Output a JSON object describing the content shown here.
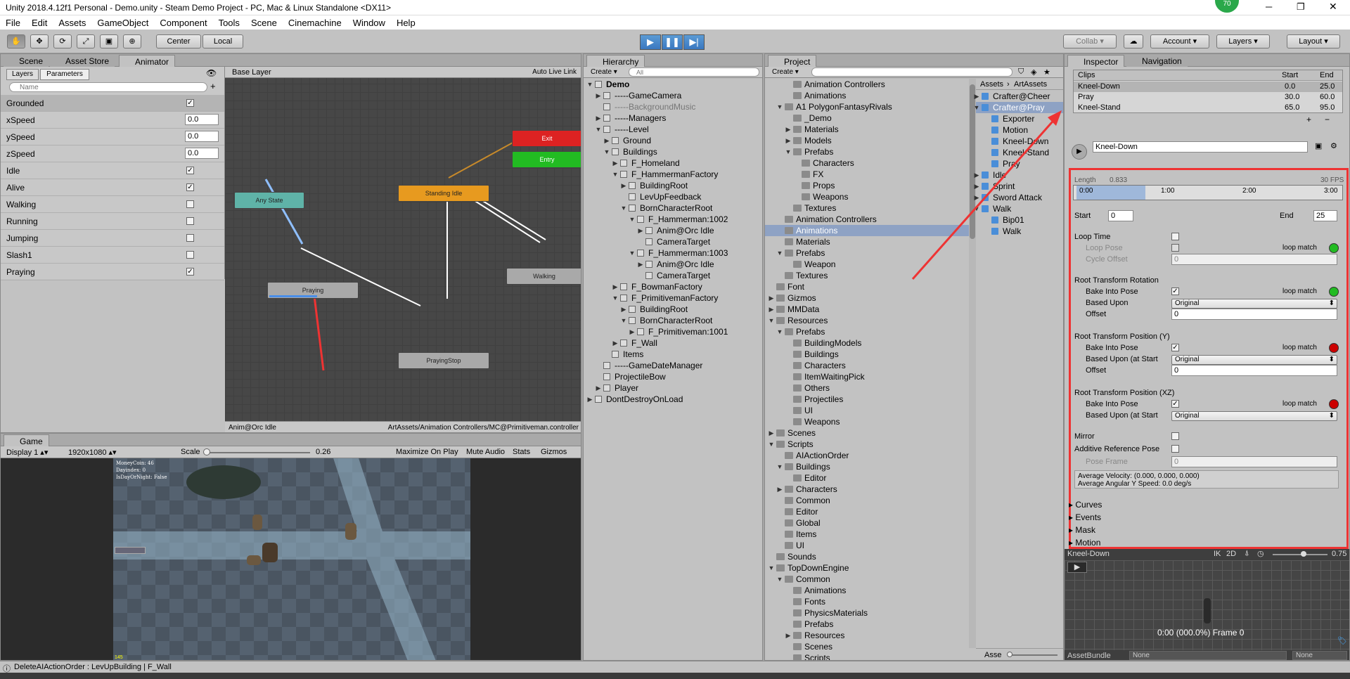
{
  "window": {
    "title": "Unity 2018.4.12f1 Personal - Demo.unity - Steam Demo Project - PC, Mac & Linux Standalone <DX11>",
    "badge": "70"
  },
  "menu": [
    "File",
    "Edit",
    "Assets",
    "GameObject",
    "Component",
    "Tools",
    "Scene",
    "Cinemachine",
    "Window",
    "Help"
  ],
  "toolbar": {
    "center": "Center",
    "local": "Local",
    "collab": "Collab",
    "account": "Account",
    "layers": "Layers",
    "layout": "Layout"
  },
  "animator_panel": {
    "tabs": [
      "Scene",
      "Asset Store",
      "Animator"
    ],
    "subtabs": [
      "Layers",
      "Parameters"
    ],
    "search_placeholder": "Name",
    "base_layer": "Base Layer",
    "auto_live": "Auto Live Link",
    "footer_left": "Anim@Orc Idle",
    "footer_right": "ArtAssets/Animation Controllers/MC@Primitiveman.controller",
    "params": [
      {
        "name": "Grounded",
        "type": "bool",
        "value": "true"
      },
      {
        "name": "xSpeed",
        "type": "float",
        "value": "0.0"
      },
      {
        "name": "ySpeed",
        "type": "float",
        "value": "0.0"
      },
      {
        "name": "zSpeed",
        "type": "float",
        "value": "0.0"
      },
      {
        "name": "Idle",
        "type": "bool",
        "value": "true"
      },
      {
        "name": "Alive",
        "type": "bool",
        "value": "true"
      },
      {
        "name": "Walking",
        "type": "bool",
        "value": "false"
      },
      {
        "name": "Running",
        "type": "bool",
        "value": "false"
      },
      {
        "name": "Jumping",
        "type": "bool",
        "value": "false"
      },
      {
        "name": "Slash1",
        "type": "bool",
        "value": "false"
      },
      {
        "name": "Praying",
        "type": "bool",
        "value": "true"
      }
    ],
    "nodes": {
      "exit": "Exit",
      "entry": "Entry",
      "any": "Any State",
      "standing": "Standing Idle",
      "praying": "Praying",
      "walking": "Walking",
      "prayingstop": "PrayingStop"
    }
  },
  "game_panel": {
    "tab": "Game",
    "display": "Display 1",
    "resolution": "1920x1080",
    "scale_label": "Scale",
    "scale_value": "0.26",
    "buttons": [
      "Maximize On Play",
      "Mute Audio",
      "Stats",
      "Gizmos"
    ],
    "hud": [
      "MoneyCoin: 46",
      "Dayindex: 0",
      "IsDayOrNight: False"
    ],
    "fps": "145"
  },
  "hierarchy": {
    "tab": "Hierarchy",
    "create": "Create",
    "search_placeholder": "All",
    "items": [
      {
        "t": "Demo",
        "d": 0,
        "f": "open",
        "bold": true
      },
      {
        "t": "-----GameCamera",
        "d": 1,
        "f": "closed"
      },
      {
        "t": "-----BackgroundMusic",
        "d": 1,
        "f": "",
        "gray": true
      },
      {
        "t": "-----Managers",
        "d": 1,
        "f": "closed"
      },
      {
        "t": "-----Level",
        "d": 1,
        "f": "open"
      },
      {
        "t": "Ground",
        "d": 2,
        "f": "closed"
      },
      {
        "t": "Buildings",
        "d": 2,
        "f": "open"
      },
      {
        "t": "F_Homeland",
        "d": 3,
        "f": "closed"
      },
      {
        "t": "F_HammermanFactory",
        "d": 3,
        "f": "open"
      },
      {
        "t": "BuildingRoot",
        "d": 4,
        "f": "closed"
      },
      {
        "t": "LevUpFeedback",
        "d": 4,
        "f": ""
      },
      {
        "t": "BornCharacterRoot",
        "d": 4,
        "f": "open"
      },
      {
        "t": "F_Hammerman:1002",
        "d": 5,
        "f": "open"
      },
      {
        "t": "Anim@Orc Idle",
        "d": 6,
        "f": "closed"
      },
      {
        "t": "CameraTarget",
        "d": 6,
        "f": ""
      },
      {
        "t": "F_Hammerman:1003",
        "d": 5,
        "f": "open"
      },
      {
        "t": "Anim@Orc Idle",
        "d": 6,
        "f": "closed"
      },
      {
        "t": "CameraTarget",
        "d": 6,
        "f": ""
      },
      {
        "t": "F_BowmanFactory",
        "d": 3,
        "f": "closed"
      },
      {
        "t": "F_PrimitivemanFactory",
        "d": 3,
        "f": "open"
      },
      {
        "t": "BuildingRoot",
        "d": 4,
        "f": "closed"
      },
      {
        "t": "BornCharacterRoot",
        "d": 4,
        "f": "open"
      },
      {
        "t": "F_Primitiveman:1001",
        "d": 5,
        "f": "closed"
      },
      {
        "t": "F_Wall",
        "d": 3,
        "f": "closed"
      },
      {
        "t": "Items",
        "d": 2,
        "f": ""
      },
      {
        "t": "-----GameDateManager",
        "d": 1,
        "f": ""
      },
      {
        "t": "ProjectileBow",
        "d": 1,
        "f": ""
      },
      {
        "t": "Player",
        "d": 1,
        "f": "closed"
      },
      {
        "t": "DontDestroyOnLoad",
        "d": 0,
        "f": "closed"
      }
    ]
  },
  "project": {
    "tab": "Project",
    "create": "Create",
    "tree": [
      {
        "t": "Animation Controllers",
        "d": 3,
        "f": ""
      },
      {
        "t": "Animations",
        "d": 3,
        "f": ""
      },
      {
        "t": "A1 PolygonFantasyRivals",
        "d": 2,
        "f": "open"
      },
      {
        "t": "_Demo",
        "d": 3,
        "f": ""
      },
      {
        "t": "Materials",
        "d": 3,
        "f": "closed"
      },
      {
        "t": "Models",
        "d": 3,
        "f": "closed"
      },
      {
        "t": "Prefabs",
        "d": 3,
        "f": "open"
      },
      {
        "t": "Characters",
        "d": 4,
        "f": ""
      },
      {
        "t": "FX",
        "d": 4,
        "f": ""
      },
      {
        "t": "Props",
        "d": 4,
        "f": ""
      },
      {
        "t": "Weapons",
        "d": 4,
        "f": ""
      },
      {
        "t": "Textures",
        "d": 3,
        "f": ""
      },
      {
        "t": "Animation Controllers",
        "d": 2,
        "f": ""
      },
      {
        "t": "Animations",
        "d": 2,
        "f": "",
        "sel": true
      },
      {
        "t": "Materials",
        "d": 2,
        "f": ""
      },
      {
        "t": "Prefabs",
        "d": 2,
        "f": "open"
      },
      {
        "t": "Weapon",
        "d": 3,
        "f": ""
      },
      {
        "t": "Textures",
        "d": 2,
        "f": ""
      },
      {
        "t": "Font",
        "d": 1,
        "f": ""
      },
      {
        "t": "Gizmos",
        "d": 1,
        "f": "closed"
      },
      {
        "t": "MMData",
        "d": 1,
        "f": "closed"
      },
      {
        "t": "Resources",
        "d": 1,
        "f": "open"
      },
      {
        "t": "Prefabs",
        "d": 2,
        "f": "open"
      },
      {
        "t": "BuildingModels",
        "d": 3,
        "f": ""
      },
      {
        "t": "Buildings",
        "d": 3,
        "f": ""
      },
      {
        "t": "Characters",
        "d": 3,
        "f": ""
      },
      {
        "t": "ItemWaitingPick",
        "d": 3,
        "f": ""
      },
      {
        "t": "Others",
        "d": 3,
        "f": ""
      },
      {
        "t": "Projectiles",
        "d": 3,
        "f": ""
      },
      {
        "t": "UI",
        "d": 3,
        "f": ""
      },
      {
        "t": "Weapons",
        "d": 3,
        "f": ""
      },
      {
        "t": "Scenes",
        "d": 1,
        "f": "closed"
      },
      {
        "t": "Scripts",
        "d": 1,
        "f": "open"
      },
      {
        "t": "AIActionOrder",
        "d": 2,
        "f": ""
      },
      {
        "t": "Buildings",
        "d": 2,
        "f": "open"
      },
      {
        "t": "Editor",
        "d": 3,
        "f": ""
      },
      {
        "t": "Characters",
        "d": 2,
        "f": "closed"
      },
      {
        "t": "Common",
        "d": 2,
        "f": ""
      },
      {
        "t": "Editor",
        "d": 2,
        "f": ""
      },
      {
        "t": "Global",
        "d": 2,
        "f": ""
      },
      {
        "t": "Items",
        "d": 2,
        "f": ""
      },
      {
        "t": "UI",
        "d": 2,
        "f": ""
      },
      {
        "t": "Sounds",
        "d": 1,
        "f": ""
      },
      {
        "t": "TopDownEngine",
        "d": 1,
        "f": "open"
      },
      {
        "t": "Common",
        "d": 2,
        "f": "open"
      },
      {
        "t": "Animations",
        "d": 3,
        "f": ""
      },
      {
        "t": "Fonts",
        "d": 3,
        "f": ""
      },
      {
        "t": "PhysicsMaterials",
        "d": 3,
        "f": ""
      },
      {
        "t": "Prefabs",
        "d": 3,
        "f": ""
      },
      {
        "t": "Resources",
        "d": 3,
        "f": "closed"
      },
      {
        "t": "Scenes",
        "d": 3,
        "f": ""
      },
      {
        "t": "Scripts",
        "d": 3,
        "f": ""
      }
    ],
    "breadcrumb": [
      "Assets",
      "ArtAssets"
    ],
    "assets": [
      {
        "t": "Crafter@Cheer",
        "d": 0,
        "f": "closed"
      },
      {
        "t": "Crafter@Pray",
        "d": 0,
        "f": "open",
        "sel": true
      },
      {
        "t": "Exporter",
        "d": 1,
        "f": ""
      },
      {
        "t": "Motion",
        "d": 1,
        "f": ""
      },
      {
        "t": "Kneel-Down",
        "d": 1,
        "f": ""
      },
      {
        "t": "Kneel-Stand",
        "d": 1,
        "f": ""
      },
      {
        "t": "Pray",
        "d": 1,
        "f": ""
      },
      {
        "t": "Idle",
        "d": 0,
        "f": "closed"
      },
      {
        "t": "Sprint",
        "d": 0,
        "f": "closed"
      },
      {
        "t": "Sword Attack",
        "d": 0,
        "f": "closed"
      },
      {
        "t": "Walk",
        "d": 0,
        "f": "open"
      },
      {
        "t": "Bip01",
        "d": 1,
        "f": ""
      },
      {
        "t": "Walk",
        "d": 1,
        "f": ""
      }
    ],
    "footer": "Asse"
  },
  "inspector": {
    "tabs": [
      "Inspector",
      "Navigation"
    ],
    "clips_header": [
      "Clips",
      "Start",
      "End"
    ],
    "clips": [
      {
        "name": "Kneel-Down",
        "start": "0.0",
        "end": "25.0"
      },
      {
        "name": "Pray",
        "start": "30.0",
        "end": "60.0"
      },
      {
        "name": "Kneel-Stand",
        "start": "65.0",
        "end": "95.0"
      }
    ],
    "clip_name": "Kneel-Down",
    "length_label": "Length",
    "length_value": "0.833",
    "fps": "30 FPS",
    "timeline": [
      "0:00",
      "1:00",
      "2:00",
      "3:00"
    ],
    "start_label": "Start",
    "start_value": "0",
    "end_label": "End",
    "end_value": "25",
    "loop_time": "Loop Time",
    "loop_pose": "Loop Pose",
    "loop_match": "loop match",
    "cycle_offset": "Cycle Offset",
    "cycle_value": "0",
    "rot_title": "Root Transform Rotation",
    "bake": "Bake Into Pose",
    "based_upon": "Based Upon",
    "based_upon_start": "Based Upon (at Start",
    "original": "Original",
    "offset": "Offset",
    "offset_value": "0",
    "posy_title": "Root Transform Position (Y)",
    "posxz_title": "Root Transform Position (XZ)",
    "mirror": "Mirror",
    "additive": "Additive Reference Pose",
    "pose_frame": "Pose Frame",
    "pose_value": "0",
    "avg_vel": "Average Velocity: (0.000, 0.000, 0.000)",
    "avg_ang": "Average Angular Y Speed: 0.0 deg/s",
    "foldouts": [
      "Curves",
      "Events",
      "Mask",
      "Motion"
    ],
    "preview_name": "Kneel-Down",
    "preview_ik": "IK",
    "preview_2d": "2D",
    "preview_speed": "0.75",
    "preview_time": "0:00 (000.0%) Frame 0",
    "assetbundle_label": "AssetBundle",
    "none1": "None",
    "none2": "None",
    "colors": {
      "green": "#22bb22",
      "red": "#cc0000"
    }
  },
  "status": "DeleteAIActionOrder : LevUpBuilding | F_Wall"
}
